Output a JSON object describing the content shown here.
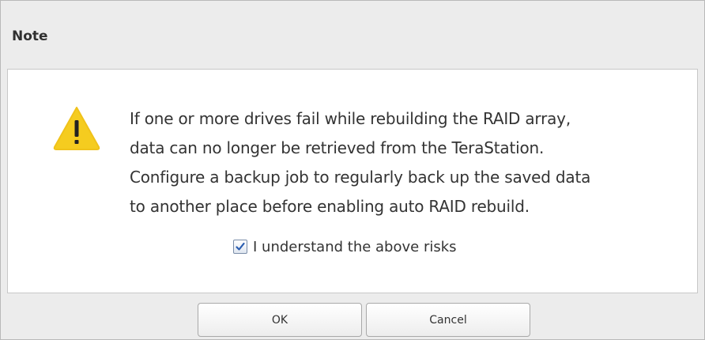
{
  "dialog": {
    "title": "Note",
    "message_lines": [
      "If one or more drives fail while rebuilding the RAID array,",
      "data can no longer be retrieved from the TeraStation.",
      "Configure a backup job to regularly back up the saved data",
      "to another place before enabling auto RAID rebuild."
    ],
    "icon": "warning-icon",
    "checkbox": {
      "label": "I understand the above risks",
      "checked": true
    },
    "buttons": {
      "ok_label": "OK",
      "cancel_label": "Cancel"
    }
  },
  "colors": {
    "warning": "#f5cc1f",
    "check": "#2a5db0",
    "panel_bg": "#ececec"
  }
}
